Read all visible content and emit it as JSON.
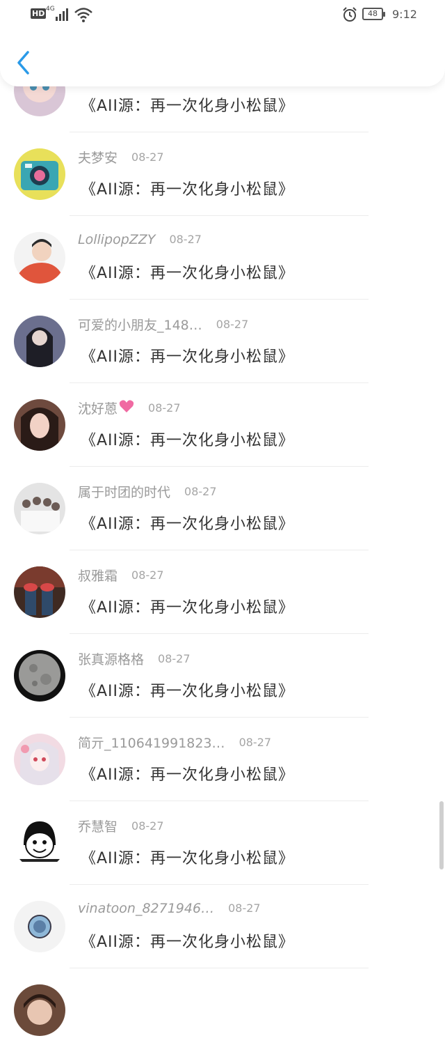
{
  "status_bar": {
    "hd": "HD",
    "network": "4G",
    "battery": "48",
    "time": "9:12"
  },
  "nav": {
    "back_icon": "chevron-left-icon"
  },
  "accent_color": "#2a9ae8",
  "comments": [
    {
      "name": "",
      "date": "",
      "message": "《AII源：再一次化身小松鼠》",
      "avatar_color": "#d9c6d6"
    },
    {
      "name": "夫梦安",
      "date": "08-27",
      "message": "《AII源：再一次化身小松鼠》",
      "avatar_color": "#3aa6b3"
    },
    {
      "name": "LollipopZZY",
      "date": "08-27",
      "message": "《AII源：再一次化身小松鼠》",
      "avatar_color": "#e0553c"
    },
    {
      "name": "可爱的小朋友_148…",
      "date": "08-27",
      "message": "《AII源：再一次化身小松鼠》",
      "avatar_color": "#5b5f7a"
    },
    {
      "name": "沈好蒽",
      "date": "08-27",
      "message": "《AII源：再一次化身小松鼠》",
      "avatar_color": "#8a5a4c",
      "heart": true
    },
    {
      "name": "属于时团的时代",
      "date": "08-27",
      "message": "《AII源：再一次化身小松鼠》",
      "avatar_color": "#d8d8d8"
    },
    {
      "name": "叔雅霜",
      "date": "08-27",
      "message": "《AII源：再一次化身小松鼠》",
      "avatar_color": "#5a3a2e"
    },
    {
      "name": "张真源格格",
      "date": "08-27",
      "message": "《AII源：再一次化身小松鼠》",
      "avatar_color": "#222222"
    },
    {
      "name": "简亓_110641991823…",
      "date": "08-27",
      "message": "《AII源：再一次化身小松鼠》",
      "avatar_color": "#e8c7d2"
    },
    {
      "name": "乔慧智",
      "date": "08-27",
      "message": "《AII源：再一次化身小松鼠》",
      "avatar_color": "#ffffff"
    },
    {
      "name": "vinatoon_8271946…",
      "date": "08-27",
      "message": "《AII源：再一次化身小松鼠》",
      "avatar_color": "#f0f0f0"
    },
    {
      "name": "",
      "date": "",
      "message": "",
      "avatar_color": "#6b4a3a"
    }
  ]
}
